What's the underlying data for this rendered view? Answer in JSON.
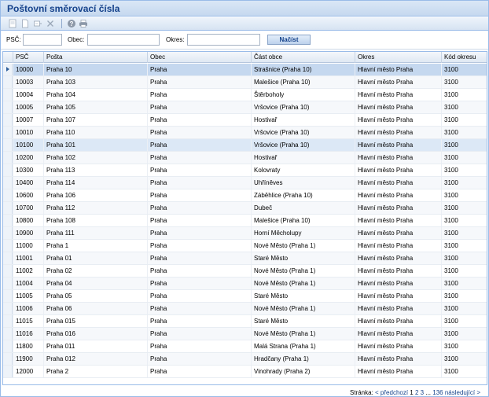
{
  "window": {
    "title": "Poštovní směrovací čísla"
  },
  "toolbar": {
    "buttons": [
      "add-record-icon",
      "new-document-icon",
      "edit-icon",
      "delete-icon",
      "help-icon",
      "print-icon"
    ]
  },
  "filter": {
    "psc_label": "PSČ:",
    "obec_label": "Obec:",
    "okres_label": "Okres:",
    "psc_value": "",
    "obec_value": "",
    "okres_value": "",
    "button_label": "Načíst"
  },
  "grid": {
    "columns": [
      "PSČ",
      "Pošta",
      "Obec",
      "Část obce",
      "Okres",
      "Kód okresu"
    ],
    "rows": [
      [
        "10000",
        "Praha 10",
        "Praha",
        "Strašnice (Praha 10)",
        "Hlavní město Praha",
        "3100"
      ],
      [
        "10003",
        "Praha 103",
        "Praha",
        "Malešice (Praha 10)",
        "Hlavní město Praha",
        "3100"
      ],
      [
        "10004",
        "Praha 104",
        "Praha",
        "Štěrboholy",
        "Hlavní město Praha",
        "3100"
      ],
      [
        "10005",
        "Praha 105",
        "Praha",
        "Vršovice (Praha 10)",
        "Hlavní město Praha",
        "3100"
      ],
      [
        "10007",
        "Praha 107",
        "Praha",
        "Hostivař",
        "Hlavní město Praha",
        "3100"
      ],
      [
        "10010",
        "Praha 110",
        "Praha",
        "Vršovice (Praha 10)",
        "Hlavní město Praha",
        "3100"
      ],
      [
        "10100",
        "Praha 101",
        "Praha",
        "Vršovice (Praha 10)",
        "Hlavní město Praha",
        "3100"
      ],
      [
        "10200",
        "Praha 102",
        "Praha",
        "Hostivař",
        "Hlavní město Praha",
        "3100"
      ],
      [
        "10300",
        "Praha 113",
        "Praha",
        "Kolovraty",
        "Hlavní město Praha",
        "3100"
      ],
      [
        "10400",
        "Praha 114",
        "Praha",
        "Uhříněves",
        "Hlavní město Praha",
        "3100"
      ],
      [
        "10600",
        "Praha 106",
        "Praha",
        "Záběhlice (Praha 10)",
        "Hlavní město Praha",
        "3100"
      ],
      [
        "10700",
        "Praha 112",
        "Praha",
        "Dubeč",
        "Hlavní město Praha",
        "3100"
      ],
      [
        "10800",
        "Praha 108",
        "Praha",
        "Malešice (Praha 10)",
        "Hlavní město Praha",
        "3100"
      ],
      [
        "10900",
        "Praha 111",
        "Praha",
        "Horní Měcholupy",
        "Hlavní město Praha",
        "3100"
      ],
      [
        "11000",
        "Praha 1",
        "Praha",
        "Nové Město (Praha 1)",
        "Hlavní město Praha",
        "3100"
      ],
      [
        "11001",
        "Praha 01",
        "Praha",
        "Staré Město",
        "Hlavní město Praha",
        "3100"
      ],
      [
        "11002",
        "Praha 02",
        "Praha",
        "Nové Město (Praha 1)",
        "Hlavní město Praha",
        "3100"
      ],
      [
        "11004",
        "Praha 04",
        "Praha",
        "Nové Město (Praha 1)",
        "Hlavní město Praha",
        "3100"
      ],
      [
        "11005",
        "Praha 05",
        "Praha",
        "Staré Město",
        "Hlavní město Praha",
        "3100"
      ],
      [
        "11006",
        "Praha 06",
        "Praha",
        "Nové Město (Praha 1)",
        "Hlavní město Praha",
        "3100"
      ],
      [
        "11015",
        "Praha 015",
        "Praha",
        "Staré Město",
        "Hlavní město Praha",
        "3100"
      ],
      [
        "11016",
        "Praha 016",
        "Praha",
        "Nové Město (Praha 1)",
        "Hlavní město Praha",
        "3100"
      ],
      [
        "11800",
        "Praha 011",
        "Praha",
        "Malá Strana (Praha 1)",
        "Hlavní město Praha",
        "3100"
      ],
      [
        "11900",
        "Praha 012",
        "Praha",
        "Hradčany (Praha 1)",
        "Hlavní město Praha",
        "3100"
      ],
      [
        "12000",
        "Praha 2",
        "Praha",
        "Vinohrady (Praha 2)",
        "Hlavní město Praha",
        "3100"
      ]
    ],
    "selected_row": 0,
    "highlighted_row": 6
  },
  "pager": {
    "label": "Stránka:",
    "prev": "< předchozí",
    "pages": [
      "1",
      "2",
      "3"
    ],
    "ellipsis": "...",
    "last": "136",
    "next": "následující >"
  }
}
